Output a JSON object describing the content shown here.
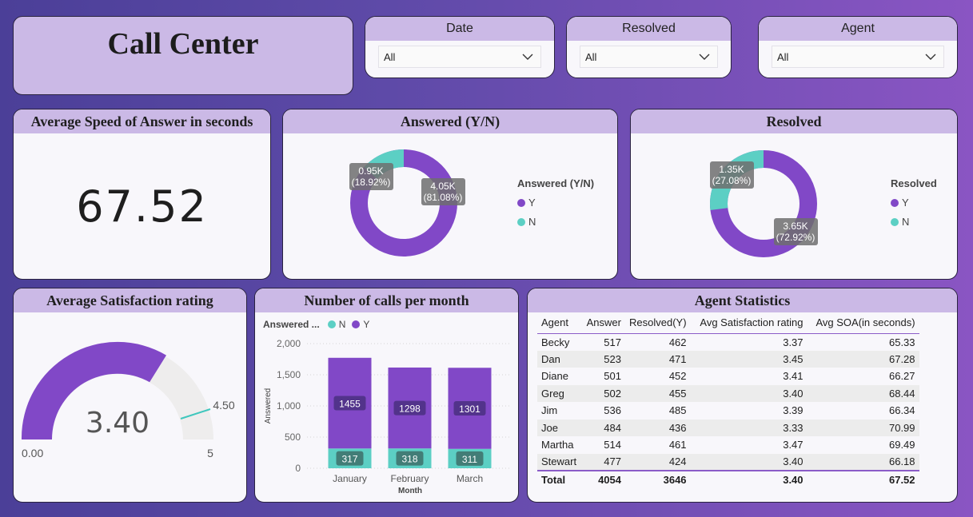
{
  "title": "Call Center",
  "filters": [
    {
      "label": "Date",
      "value": "All"
    },
    {
      "label": "Resolved",
      "value": "All"
    },
    {
      "label": "Agent",
      "value": "All"
    }
  ],
  "asa": {
    "title": "Average Speed of Answer in seconds",
    "value": "67.52"
  },
  "answered": {
    "title": "Answered (Y/N)",
    "legend_title": "Answered (Y/N)",
    "y_label": "Y",
    "n_label": "N",
    "y_value": "4.05K",
    "y_pct": "(81.08%)",
    "n_value": "0.95K",
    "n_pct": "(18.92%)"
  },
  "resolved": {
    "title": "Resolved",
    "legend_title": "Resolved",
    "y_label": "Y",
    "n_label": "N",
    "y_value": "3.65K",
    "y_pct": "(72.92%)",
    "n_value": "1.35K",
    "n_pct": "(27.08%)"
  },
  "satisfaction": {
    "title": "Average Satisfaction rating",
    "value": "3.40",
    "min": "0.00",
    "max": "5",
    "target": "4.50"
  },
  "calls": {
    "title": "Number of calls per month",
    "legend_title": "Answered ...",
    "legend_n": "N",
    "legend_y": "Y",
    "ylabel": "Answered",
    "xlabel": "Month",
    "ticks": [
      "2,000",
      "1,500",
      "1,000",
      "500",
      "0"
    ]
  },
  "agents": {
    "title": "Agent Statistics",
    "headers": [
      "Agent",
      "Answer",
      "Resolved(Y)",
      "Avg Satisfaction rating",
      "Avg SOA(in seconds)"
    ],
    "rows": [
      [
        "Becky",
        "517",
        "462",
        "3.37",
        "65.33"
      ],
      [
        "Dan",
        "523",
        "471",
        "3.45",
        "67.28"
      ],
      [
        "Diane",
        "501",
        "452",
        "3.41",
        "66.27"
      ],
      [
        "Greg",
        "502",
        "455",
        "3.40",
        "68.44"
      ],
      [
        "Jim",
        "536",
        "485",
        "3.39",
        "66.34"
      ],
      [
        "Joe",
        "484",
        "436",
        "3.33",
        "70.99"
      ],
      [
        "Martha",
        "514",
        "461",
        "3.47",
        "69.49"
      ],
      [
        "Stewart",
        "477",
        "424",
        "3.40",
        "66.18"
      ]
    ],
    "total": [
      "Total",
      "4054",
      "3646",
      "3.40",
      "67.52"
    ]
  },
  "colors": {
    "purple": "#8148c7",
    "teal": "#5ccfc4",
    "header": "#cbb9e6"
  },
  "chart_data": [
    {
      "type": "pie",
      "title": "Answered (Y/N)",
      "labels": [
        "Y",
        "N"
      ],
      "values": [
        4054,
        946
      ],
      "percent": [
        81.08,
        18.92
      ]
    },
    {
      "type": "pie",
      "title": "Resolved",
      "labels": [
        "Y",
        "N"
      ],
      "values": [
        3646,
        1354
      ],
      "percent": [
        72.92,
        27.08
      ]
    },
    {
      "type": "bar",
      "title": "Number of calls per month",
      "categories": [
        "January",
        "February",
        "March"
      ],
      "series": [
        {
          "name": "N",
          "values": [
            317,
            318,
            311
          ]
        },
        {
          "name": "Y",
          "values": [
            1455,
            1298,
            1301
          ]
        }
      ],
      "stacked": true,
      "xlabel": "Month",
      "ylabel": "Answered",
      "ylim": [
        0,
        2000
      ]
    }
  ]
}
